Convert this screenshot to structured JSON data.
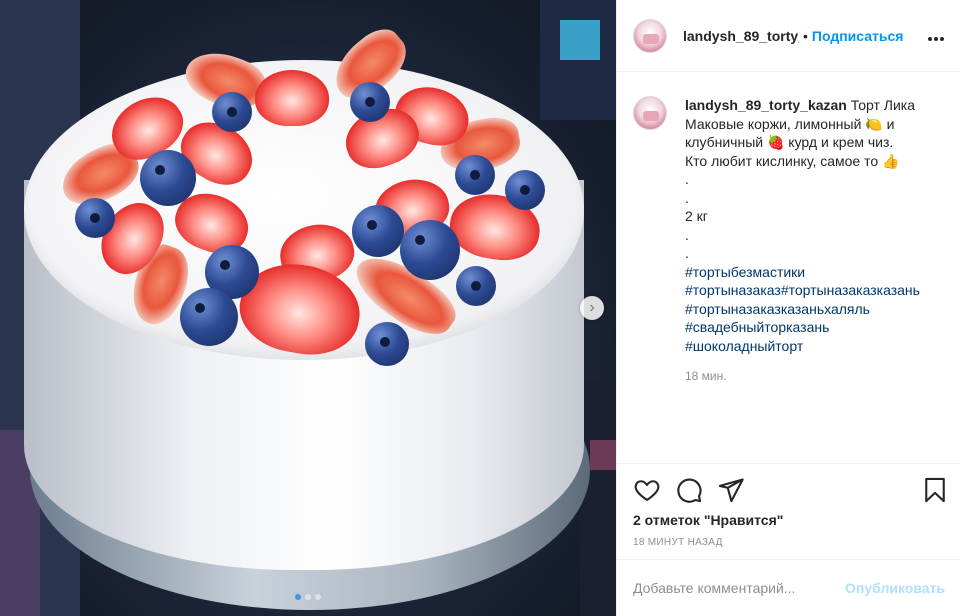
{
  "photo": {
    "alt_icon": "cake-photo",
    "next_icon": "chevron-right-icon",
    "slides_total": 3,
    "active_slide": 1
  },
  "header": {
    "username": "landysh_89_torty_kazan",
    "separator": "•",
    "follow_label": "Подписаться",
    "more_icon": "more-horizontal-icon",
    "more_label": "•••"
  },
  "caption": {
    "username": "landysh_89_torty_kazan",
    "lines": [
      "Торт Лика",
      "Маковые коржи, лимонный 🍋 и",
      "клубничный 🍓 курд и крем чиз.",
      "Кто любит кислинку, самое то 👍",
      ".",
      ".",
      "2 кг",
      ".",
      "."
    ],
    "hashtags": [
      "#тортыбезмастики",
      "#тортыназаказ#тортыназаказказань",
      "#тортыназаказказаньхаляль",
      "#свадебныйторказань",
      "#шоколадныйторт"
    ],
    "time": "18 мин."
  },
  "actions": {
    "like_icon": "heart-icon",
    "comment_icon": "comment-icon",
    "share_icon": "share-icon",
    "save_icon": "bookmark-icon",
    "likes_text": "2 отметок \"Нравится\"",
    "post_time": "18 МИНУТ НАЗАД"
  },
  "comment": {
    "placeholder": "Добавьте комментарий...",
    "post_label": "Опубликовать"
  },
  "colors": {
    "accent": "#0095f6",
    "post_disabled": "#b2dffc",
    "hashtag": "#00376b",
    "muted": "#8e8e8e",
    "text": "#262626"
  }
}
